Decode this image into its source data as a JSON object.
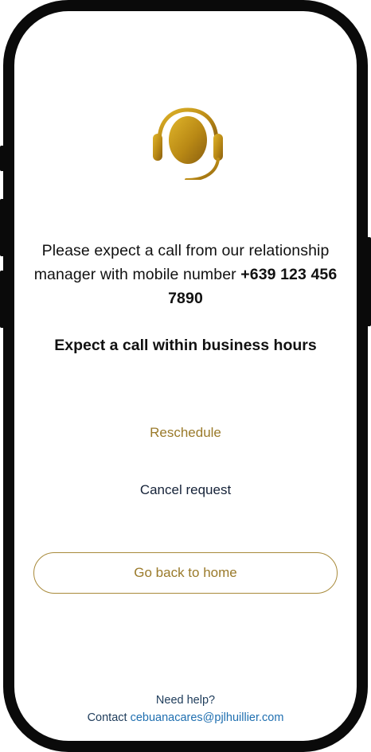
{
  "colors": {
    "gold": "#9a7a2a",
    "gold_border": "#a88a3a",
    "dark_text": "#111111",
    "navy": "#152238",
    "link": "#1f6fb0"
  },
  "icon": "headset-icon",
  "message": {
    "prefix": "Please expect a call from our relationship manager with mobile number ",
    "phone_number": "+639 123 456 7890"
  },
  "expect_text": "Expect a call within business hours",
  "actions": {
    "reschedule_label": "Reschedule",
    "cancel_label": "Cancel request",
    "home_label": "Go back to home"
  },
  "footer": {
    "need_help": "Need help?",
    "contact_prefix": "Contact",
    "email": "cebuanacares@pjlhuillier.com"
  }
}
